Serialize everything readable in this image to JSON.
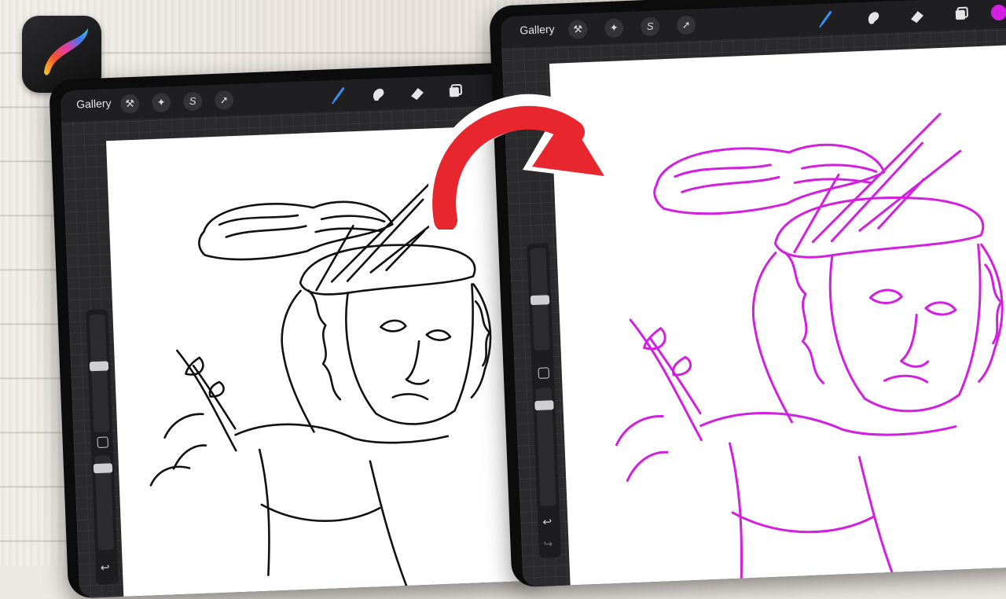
{
  "app_icon": "procreate-brush-logo-icon",
  "left_tablet": {
    "toolbar": {
      "gallery_label": "Gallery",
      "left_tools": [
        "wrench-icon",
        "magic-wand-icon",
        "selection-s-icon",
        "transform-arrow-icon"
      ],
      "right_tools": [
        "brush-icon",
        "smudge-icon",
        "eraser-icon",
        "layers-icon"
      ]
    },
    "ink_color": "#111111",
    "sidebar": {
      "undo_label": "↩"
    }
  },
  "right_tablet": {
    "toolbar": {
      "gallery_label": "Gallery",
      "left_tools": [
        "wrench-icon",
        "magic-wand-icon",
        "selection-s-icon",
        "transform-arrow-icon"
      ],
      "right_tools": [
        "brush-icon",
        "smudge-icon",
        "eraser-icon",
        "layers-icon"
      ],
      "active_color": "#d21fe0"
    },
    "ink_color": "#d21fe0",
    "sidebar": {
      "undo_label": "↩",
      "redo_label": "↪"
    }
  },
  "arrow_color": "#e8262d",
  "tool_glyphs": {
    "wrench": "🔧",
    "wand": "✦",
    "s": "S",
    "arrow": "➚"
  }
}
